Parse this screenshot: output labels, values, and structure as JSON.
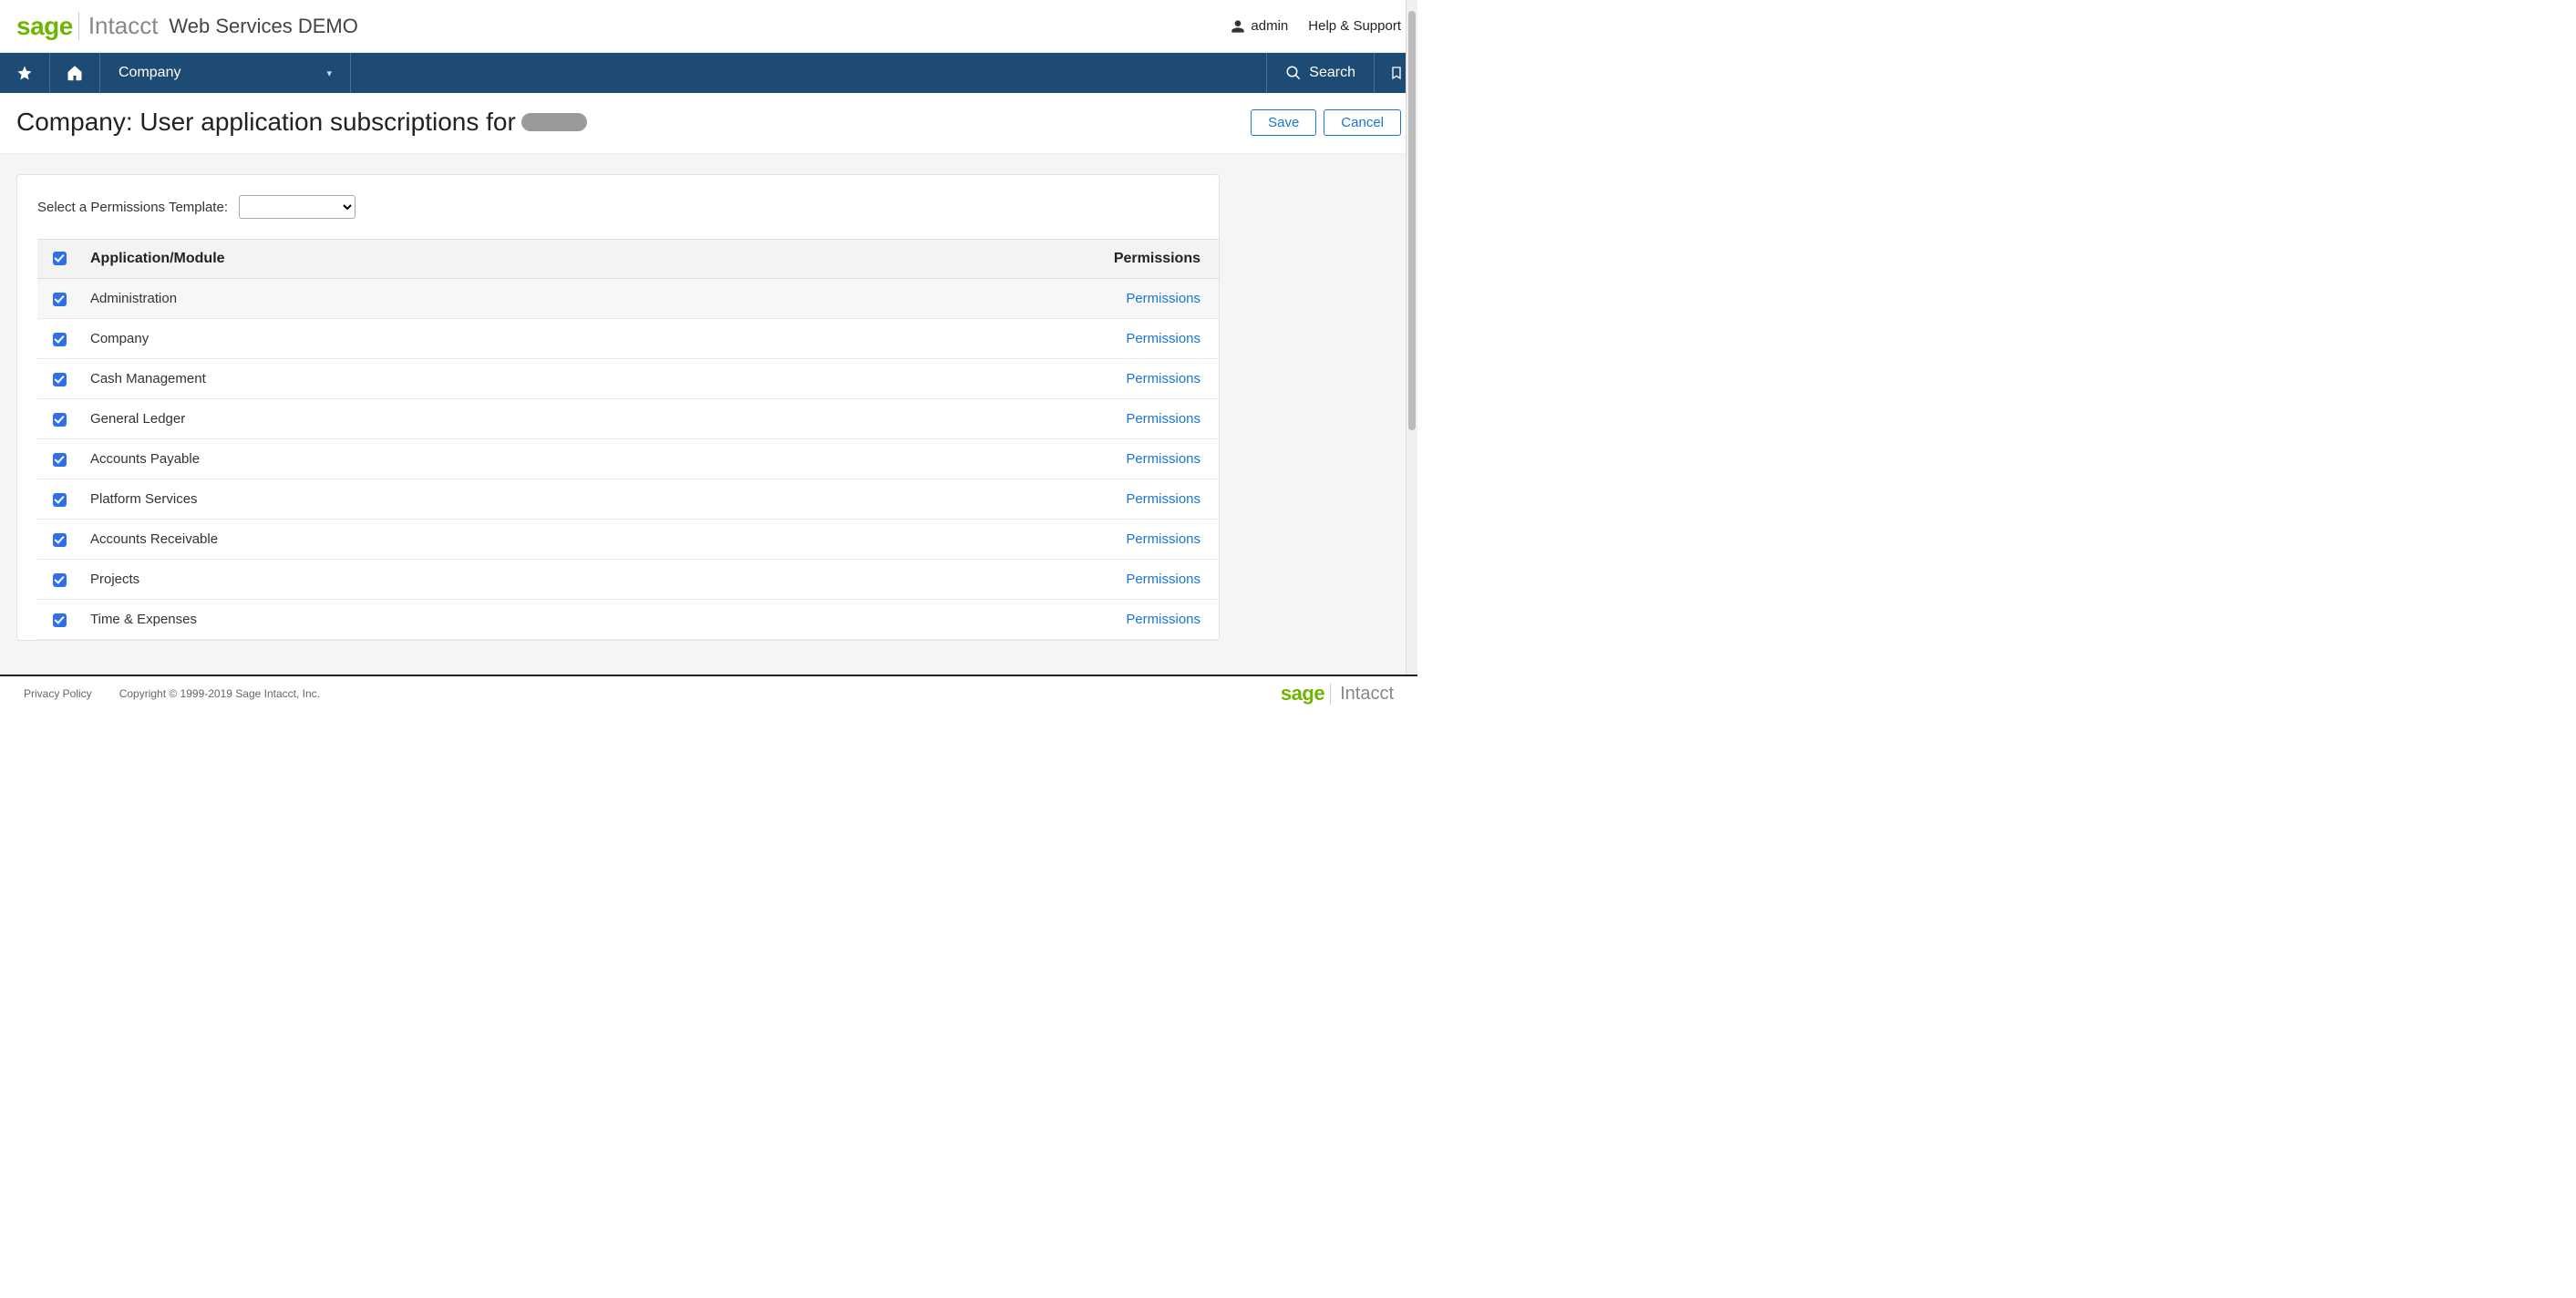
{
  "brand": {
    "sage": "sage",
    "intacct": "Intacct"
  },
  "header": {
    "app_title": "Web Services DEMO",
    "user_label": "admin",
    "help_label": "Help & Support"
  },
  "nav": {
    "dropdown_label": "Company",
    "search_label": "Search"
  },
  "page": {
    "title_prefix": "Company: User application subscriptions for",
    "save_label": "Save",
    "cancel_label": "Cancel"
  },
  "panel": {
    "template_label": "Select a Permissions Template:"
  },
  "table": {
    "col_module": "Application/Module",
    "col_permissions": "Permissions",
    "perm_link_label": "Permissions",
    "rows": [
      {
        "name": "Administration",
        "checked": true,
        "hover": true
      },
      {
        "name": "Company",
        "checked": true
      },
      {
        "name": "Cash Management",
        "checked": true
      },
      {
        "name": "General Ledger",
        "checked": true
      },
      {
        "name": "Accounts Payable",
        "checked": true
      },
      {
        "name": "Platform Services",
        "checked": true
      },
      {
        "name": "Accounts Receivable",
        "checked": true
      },
      {
        "name": "Projects",
        "checked": true
      },
      {
        "name": "Time & Expenses",
        "checked": true
      }
    ]
  },
  "footer": {
    "privacy": "Privacy Policy",
    "copyright": "Copyright © 1999-2019 Sage Intacct, Inc."
  }
}
